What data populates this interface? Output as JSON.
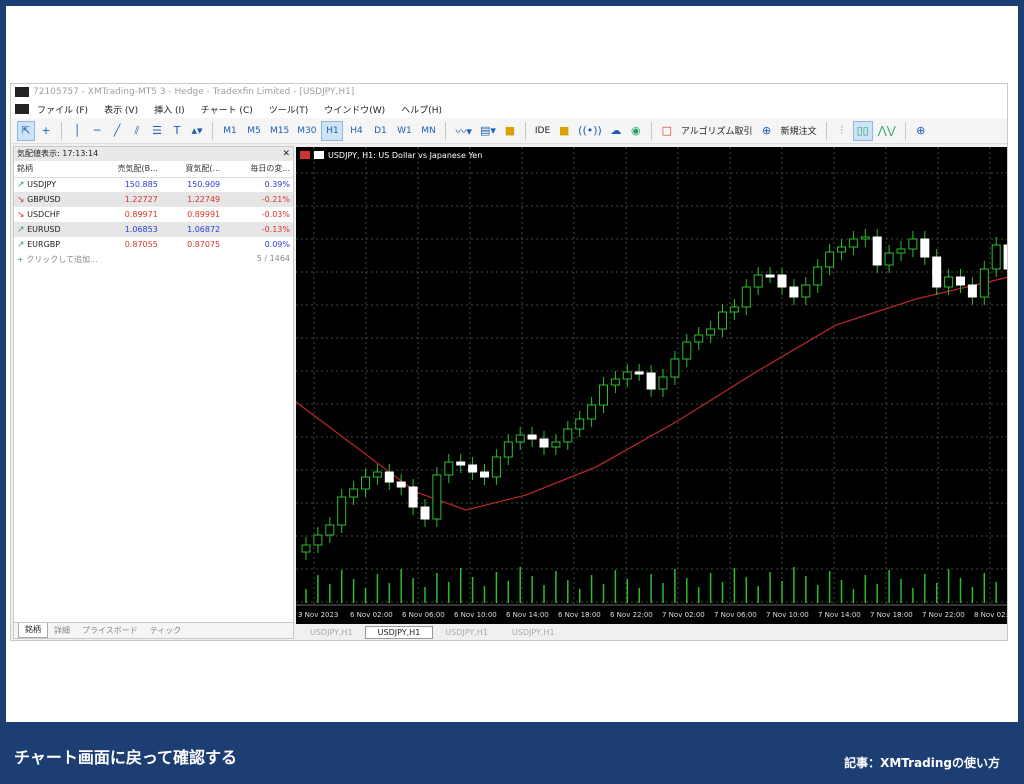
{
  "window": {
    "title": "72105757 - XMTrading-MT5 3 - Hedge - Tradexfin Limited - [USDJPY,H1]"
  },
  "menu": [
    "ファイル (F)",
    "表示 (V)",
    "挿入 (I)",
    "チャート (C)",
    "ツール(T)",
    "ウインドウ(W)",
    "ヘルプ(H)"
  ],
  "toolbar": {
    "timeframes": [
      "M1",
      "M5",
      "M15",
      "M30",
      "H1",
      "H4",
      "D1",
      "W1",
      "MN"
    ],
    "active_timeframe": "H1",
    "ide_label": "IDE",
    "algo_label": "アルゴリズム取引",
    "new_order_label": "新規注文"
  },
  "market_watch": {
    "title": "気配値表示: 17:13:14",
    "columns": [
      "銘柄",
      "売気配(B...",
      "買気配(...",
      "毎日の変..."
    ],
    "rows": [
      {
        "symbol": "USDJPY",
        "dir": "up",
        "bid": "150.885",
        "ask": "150.909",
        "change": "0.39%",
        "bid_color": "#2a3cd8",
        "ask_color": "#2a3cd8",
        "change_color": "#2a3cd8"
      },
      {
        "symbol": "GBPUSD",
        "dir": "down",
        "bid": "1.22727",
        "ask": "1.22749",
        "change": "-0.21%",
        "bid_color": "#d9342b",
        "ask_color": "#d9342b",
        "change_color": "#d9342b"
      },
      {
        "symbol": "USDCHF",
        "dir": "down",
        "bid": "0.89971",
        "ask": "0.89991",
        "change": "-0.03%",
        "bid_color": "#d9342b",
        "ask_color": "#d9342b",
        "change_color": "#d9342b"
      },
      {
        "symbol": "EURUSD",
        "dir": "up",
        "bid": "1.06853",
        "ask": "1.06872",
        "change": "-0.13%",
        "bid_color": "#2a3cd8",
        "ask_color": "#2a3cd8",
        "change_color": "#d9342b"
      },
      {
        "symbol": "EURGBP",
        "dir": "up",
        "bid": "0.87055",
        "ask": "0.87075",
        "change": "0.09%",
        "bid_color": "#d9342b",
        "ask_color": "#d9342b",
        "change_color": "#2a3cd8"
      }
    ],
    "add_label": "クリックして追加...",
    "count": "5 / 1464",
    "tabs": [
      "銘柄",
      "詳細",
      "プライスボード",
      "ティック"
    ]
  },
  "chart": {
    "header": "USDJPY, H1:  US Dollar vs Japanese Yen",
    "time_labels": [
      "3 Nov 2023",
      "6 Nov 02:00",
      "6 Nov 06:00",
      "6 Nov 10:00",
      "6 Nov 14:00",
      "6 Nov 18:00",
      "6 Nov 22:00",
      "7 Nov 02:00",
      "7 Nov 06:00",
      "7 Nov 10:00",
      "7 Nov 14:00",
      "7 Nov 18:00",
      "7 Nov 22:00",
      "8 Nov 02:00",
      "8 Nov 06:00"
    ],
    "tabs": [
      "USDJPY,H1",
      "USDJPY,H1",
      "USDJPY,H1",
      "USDJPY,H1"
    ],
    "active_tab": 1
  },
  "footer": {
    "caption": "チャート画面に戻って確認する",
    "credit": "記事：XMTradingの使い方"
  }
}
